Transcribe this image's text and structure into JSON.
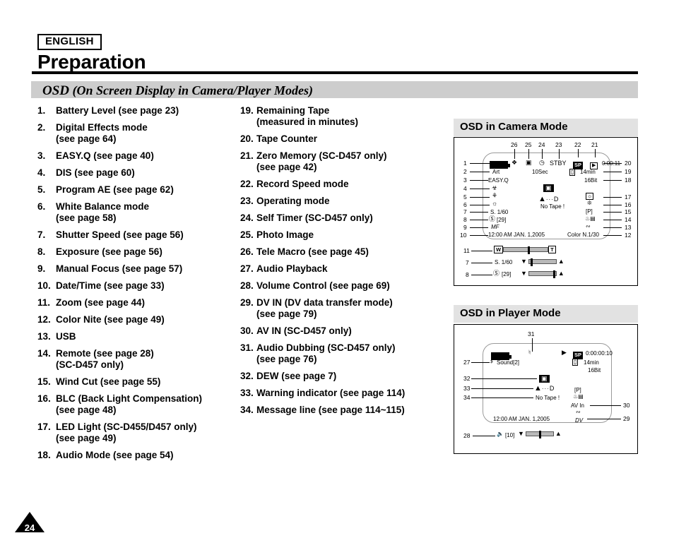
{
  "header": {
    "language_badge": "ENGLISH",
    "title": "Preparation",
    "section_title_lead": "OSD",
    "section_title_rest": "(On Screen Display in Camera/Player Modes)"
  },
  "list_left": [
    {
      "num": "1.",
      "line1": "Battery Level (see page 23)",
      "line2": ""
    },
    {
      "num": "2.",
      "line1": "Digital Effects mode",
      "line2": "(see page 64)"
    },
    {
      "num": "3.",
      "line1": "EASY.Q (see page 40)",
      "line2": ""
    },
    {
      "num": "4.",
      "line1": "DIS (see page 60)",
      "line2": ""
    },
    {
      "num": "5.",
      "line1": "Program AE (see page 62)",
      "line2": ""
    },
    {
      "num": "6.",
      "line1": "White Balance mode",
      "line2": "(see page 58)"
    },
    {
      "num": "7.",
      "line1": "Shutter Speed (see page 56)",
      "line2": ""
    },
    {
      "num": "8.",
      "line1": "Exposure (see page 56)",
      "line2": ""
    },
    {
      "num": "9.",
      "line1": "Manual Focus (see page 57)",
      "line2": ""
    },
    {
      "num": "10.",
      "line1": "Date/Time (see page 33)",
      "line2": ""
    },
    {
      "num": "11.",
      "line1": "Zoom (see page 44)",
      "line2": ""
    },
    {
      "num": "12.",
      "line1": "Color Nite (see page 49)",
      "line2": ""
    },
    {
      "num": "13.",
      "line1": "USB",
      "line2": ""
    },
    {
      "num": "14.",
      "line1": "Remote (see page 28)",
      "line2": "(SC-D457 only)"
    },
    {
      "num": "15.",
      "line1": "Wind Cut (see page 55)",
      "line2": ""
    },
    {
      "num": "16.",
      "line1": "BLC (Back Light Compensation)",
      "line2": "(see page 48)"
    },
    {
      "num": "17.",
      "line1": "LED Light (SC-D455/D457 only)",
      "line2": "(see page 49)"
    },
    {
      "num": "18.",
      "line1": "Audio Mode (see page 54)",
      "line2": ""
    }
  ],
  "list_mid": [
    {
      "num": "19.",
      "line1": "Remaining Tape",
      "line2": "(measured in minutes)"
    },
    {
      "num": "20.",
      "line1": "Tape Counter",
      "line2": ""
    },
    {
      "num": "21.",
      "line1": "Zero Memory (SC-D457 only)",
      "line2": "(see page 42)"
    },
    {
      "num": "22.",
      "line1": "Record Speed mode",
      "line2": ""
    },
    {
      "num": "23.",
      "line1": "Operating mode",
      "line2": ""
    },
    {
      "num": "24.",
      "line1": "Self Timer (SC-D457 only)",
      "line2": ""
    },
    {
      "num": "25.",
      "line1": "Photo Image",
      "line2": ""
    },
    {
      "num": "26.",
      "line1": "Tele Macro (see page 45)",
      "line2": ""
    },
    {
      "num": "27.",
      "line1": "Audio Playback",
      "line2": ""
    },
    {
      "num": "28.",
      "line1": "Volume Control (see page 69)",
      "line2": ""
    },
    {
      "num": "29.",
      "line1": "DV IN (DV data transfer mode)",
      "line2": "(see page 79)"
    },
    {
      "num": "30.",
      "line1": "AV IN (SC-D457 only)",
      "line2": ""
    },
    {
      "num": "31.",
      "line1": "Audio Dubbing (SC-D457 only)",
      "line2": "(see page 76)"
    },
    {
      "num": "32.",
      "line1": "DEW (see page 7)",
      "line2": ""
    },
    {
      "num": "33.",
      "line1": "Warning indicator (see page 114)",
      "line2": ""
    },
    {
      "num": "34.",
      "line1": "Message line (see page 114~115)",
      "line2": ""
    }
  ],
  "camera_panel": {
    "heading": "OSD in Camera Mode",
    "top_callouts": [
      "26",
      "25",
      "24",
      "23",
      "22",
      "21"
    ],
    "left_callouts": [
      "1",
      "2",
      "3",
      "4",
      "5",
      "6",
      "7",
      "8",
      "9",
      "10"
    ],
    "right_callouts": [
      "20",
      "19",
      "18",
      "17",
      "16",
      "15",
      "14",
      "13",
      "12"
    ],
    "below_callouts": [
      "11",
      "7",
      "8"
    ],
    "screen_text": {
      "effect": "Art",
      "easyq": "EASY.Q",
      "selftimer_sec": "10Sec",
      "stby": "STBY",
      "record_speed": "SP",
      "counter": "0:00:11",
      "remaining_tape": "14min",
      "audio_mode": "16Bit",
      "shutter": "S. 1/60",
      "exposure": "[29]",
      "manual_focus": "MF",
      "datetime": "12:00 AM JAN. 1,2005",
      "colornite": "Color N.1/30",
      "tape_warn": "No Tape !",
      "eject_hint": "D",
      "zoom_w": "W",
      "zoom_t": "T",
      "shutter_bar_label": "S. 1/60",
      "exposure_bar_label": "[29]"
    }
  },
  "player_panel": {
    "heading": "OSD in Player Mode",
    "callouts": {
      "top": "31",
      "left": [
        "27",
        "32",
        "33",
        "34"
      ],
      "right": [
        "30",
        "29"
      ],
      "bottom": "28"
    },
    "screen_text": {
      "audio_playback": "Sound[2]",
      "record_speed": "SP",
      "counter": "0:00:00:10",
      "remaining_tape": "14min",
      "audio_mode": "16Bit",
      "tape_warn": "No Tape !",
      "eject_hint": "D",
      "datetime": "12:00 AM JAN. 1,2005",
      "program_ae": "[P]",
      "av_in": "AV In",
      "dv_in": "DV",
      "volume": "[10]"
    }
  },
  "footer": {
    "page_number": "24"
  }
}
